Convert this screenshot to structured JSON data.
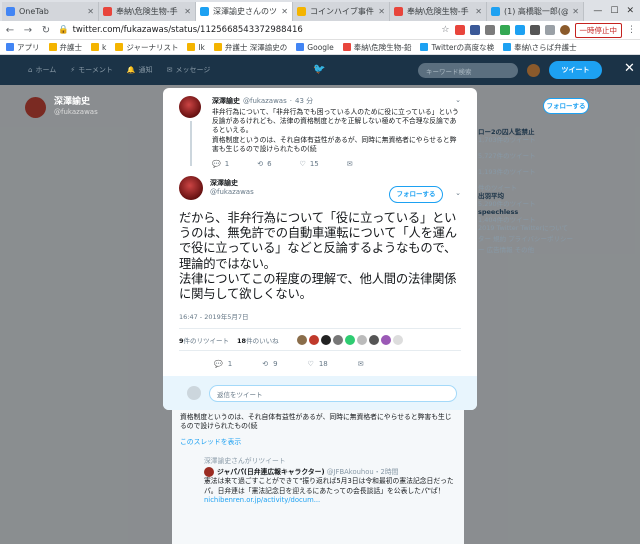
{
  "browser": {
    "tabs": [
      {
        "title": "OneTab",
        "color": "#4285f4",
        "active": false
      },
      {
        "title": "奉納\\危険生物-手",
        "color": "#e8453c",
        "active": false
      },
      {
        "title": "深澤諭史さんのツイ",
        "color": "#1da1f2",
        "active": true
      },
      {
        "title": "コインハイブ事件.",
        "color": "#f4b400",
        "active": false
      },
      {
        "title": "奉納\\危険生物-手",
        "color": "#e8453c",
        "active": false
      },
      {
        "title": "(1) 高橋聡一郎(@",
        "color": "#1da1f2",
        "active": false
      }
    ],
    "url": "twitter.com/fukazawas/status/1125668543372988416",
    "pause_label": "一時停止中",
    "bookmarks": [
      "アプリ",
      "弁護士",
      "k",
      "ジャーナリスト",
      "lk",
      "弁護士 深澤諭史の",
      "Google",
      "奉納\\危険生物-鉛",
      "Twitterの高度な検",
      "奉納\\さらば弁護士"
    ]
  },
  "twitter_nav": {
    "home": "ホーム",
    "moments": "モーメント",
    "notifications": "通知",
    "messages": "メッセージ",
    "search_placeholder": "キーワード検索",
    "tweet_button": "ツイート"
  },
  "background": {
    "profile_name": "深澤諭史",
    "profile_handle": "@fukazawas",
    "follow": "フォローする",
    "side_items": [
      {
        "title": "ロー2の囚人監禁止",
        "meta": "1,703件のツイート"
      },
      {
        "title": "",
        "meta": "5,727件のツイート"
      },
      {
        "title": "",
        "meta": "1,193件のツイート"
      },
      {
        "title": "",
        "meta": "件のツイート"
      },
      {
        "title": "出羽平均",
        "meta": "5,290件のツイート"
      },
      {
        "title": "speechless",
        "meta": "1,404件のツイート"
      }
    ],
    "footer_line1": "2019 Twitter  Twitterについて",
    "footer_line2": "ター  規約  プライバシーポリシー",
    "footer_line3": "ー  広告情報  その他",
    "bottom_text_1": "あるけれども、法律の資格制度とかを正解しない極めて不合理な反論であるといえる。",
    "bottom_text_2": "資格制度というのは、それ自体有益性があるが、同時に無資格者にやらせると弊害も生じるので設けられたもの(続",
    "show_thread": "このスレッドを表示",
    "retweeted_by": "深澤諭史さんがリツイート",
    "retweet_name": "ジャパパ(日弁連広報キャラクター)",
    "retweet_handle": "@JFBAkouhou・2時間",
    "retweet_text": "憲法は来て過ごすことができて\"振り返れば5月3日は令和最初の憲法記念日だったパ。日弁連は「憲法記念日を迎えるにあたっての会長談話」を公表したパ\"ぱ！",
    "retweet_link": "nichibenren.or.jp/activity/docum..."
  },
  "modal": {
    "parent": {
      "name": "深澤諭史",
      "handle": "@fukazawas",
      "time": "43 分",
      "text": "非弁行為について、「非弁行為でも困っている人のために役に立っている」という反論があるけれども、法律の資格制度とかを正解しない極めて不合理な反論であるといえる。\n資格制度というのは、それ自体有益性があるが、同時に無資格者にやらせると弊害も生じるので設けられたもの(続",
      "replies": "1",
      "retweets": "6",
      "likes": "15"
    },
    "main": {
      "name": "深澤諭史",
      "handle": "@fukazawas",
      "follow": "フォローする",
      "text": "だから、非弁行為について「役に立っている」というのは、無免許での自動車運転について「人を運んで役に立っている」などと反論するようなもので、理論的ではない。\n法律についてこの程度の理解で、他人間の法律関係に関与して欲しくない。",
      "timestamp": "16:47 - 2019年5月7日",
      "retweet_count": "9",
      "retweet_label": "件のリツイート",
      "like_count": "18",
      "like_label": "件のいいね",
      "replies": "1",
      "retweets": "9",
      "likes": "18"
    },
    "reply_placeholder": "返信をツイート"
  }
}
